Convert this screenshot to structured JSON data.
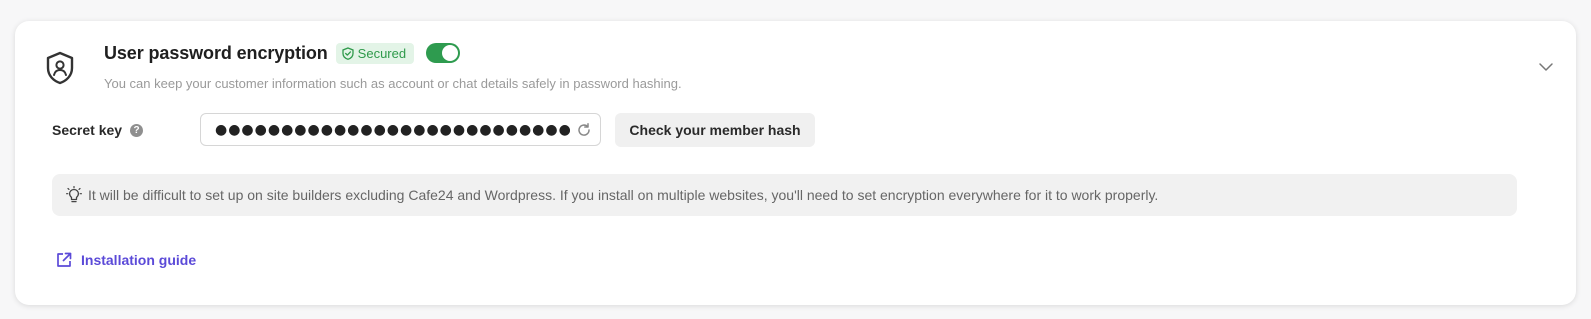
{
  "section": {
    "title": "User password encryption",
    "badge": "Secured",
    "toggle_on": true,
    "description": "You can keep your customer information such as account or chat details safely in password hashing."
  },
  "secret_key": {
    "label": "Secret key",
    "help_glyph": "?",
    "value": "●●●●●●●●●●●●●●●●●●●●●●●●●●●●●●●●●●●●●●●●●●●●●●●●●●●●●●●●●●●●",
    "check_button": "Check your member hash"
  },
  "notice": {
    "text": "It will be difficult to set up on site builders excluding Cafe24 and Wordpress. If you install on multiple websites, you'll need to set encryption everywhere for it to work properly."
  },
  "guide_link": {
    "label": "Installation guide"
  },
  "colors": {
    "accent_green": "#2e9b4f",
    "badge_bg": "#e3f4e7",
    "link_purple": "#5b4ad8"
  },
  "icons": [
    "user-shield-icon",
    "shield-check-icon",
    "chevron-down-icon",
    "help-icon",
    "refresh-icon",
    "lightbulb-icon",
    "external-link-icon"
  ]
}
